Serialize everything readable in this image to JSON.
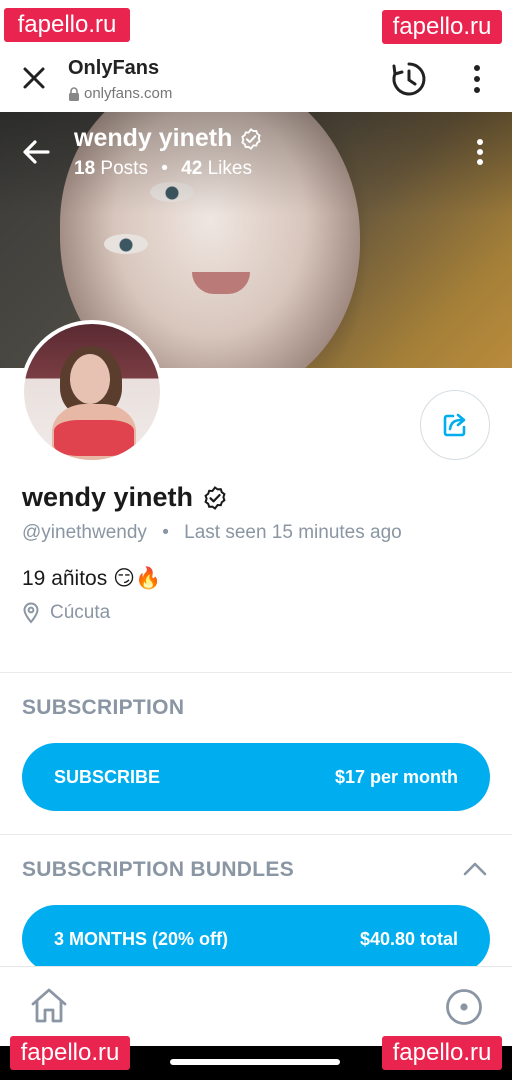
{
  "browser": {
    "title": "OnlyFans",
    "url": "onlyfans.com"
  },
  "watermark": "fapello.ru",
  "cover": {
    "name": "wendy yineth",
    "posts_count": "18",
    "posts_label": "Posts",
    "separator": "•",
    "likes_count": "42",
    "likes_label": "Likes"
  },
  "profile": {
    "name": "wendy yineth",
    "handle": "@yinethwendy",
    "separator": "•",
    "last_seen": "Last seen 15 minutes ago",
    "bio": "19 añitos 😏🔥",
    "location": "Cúcuta"
  },
  "subscription": {
    "title": "SUBSCRIPTION",
    "button_label": "SUBSCRIBE",
    "button_price": "$17 per month"
  },
  "bundles": {
    "title": "SUBSCRIPTION BUNDLES",
    "items": [
      {
        "label": "3 MONTHS (20% off)",
        "price": "$40.80 total"
      }
    ]
  },
  "colors": {
    "accent": "#00aeef",
    "muted_text": "#8a96a3",
    "watermark_bg": "#e8244f"
  },
  "icons": {
    "close": "close-icon",
    "history": "history-icon",
    "menu": "more-vertical-icon",
    "back": "arrow-left-icon",
    "verified": "verified-badge-icon",
    "share": "share-icon",
    "location": "location-pin-icon",
    "collapse": "chevron-up-icon",
    "home": "home-icon",
    "profile": "profile-icon"
  }
}
